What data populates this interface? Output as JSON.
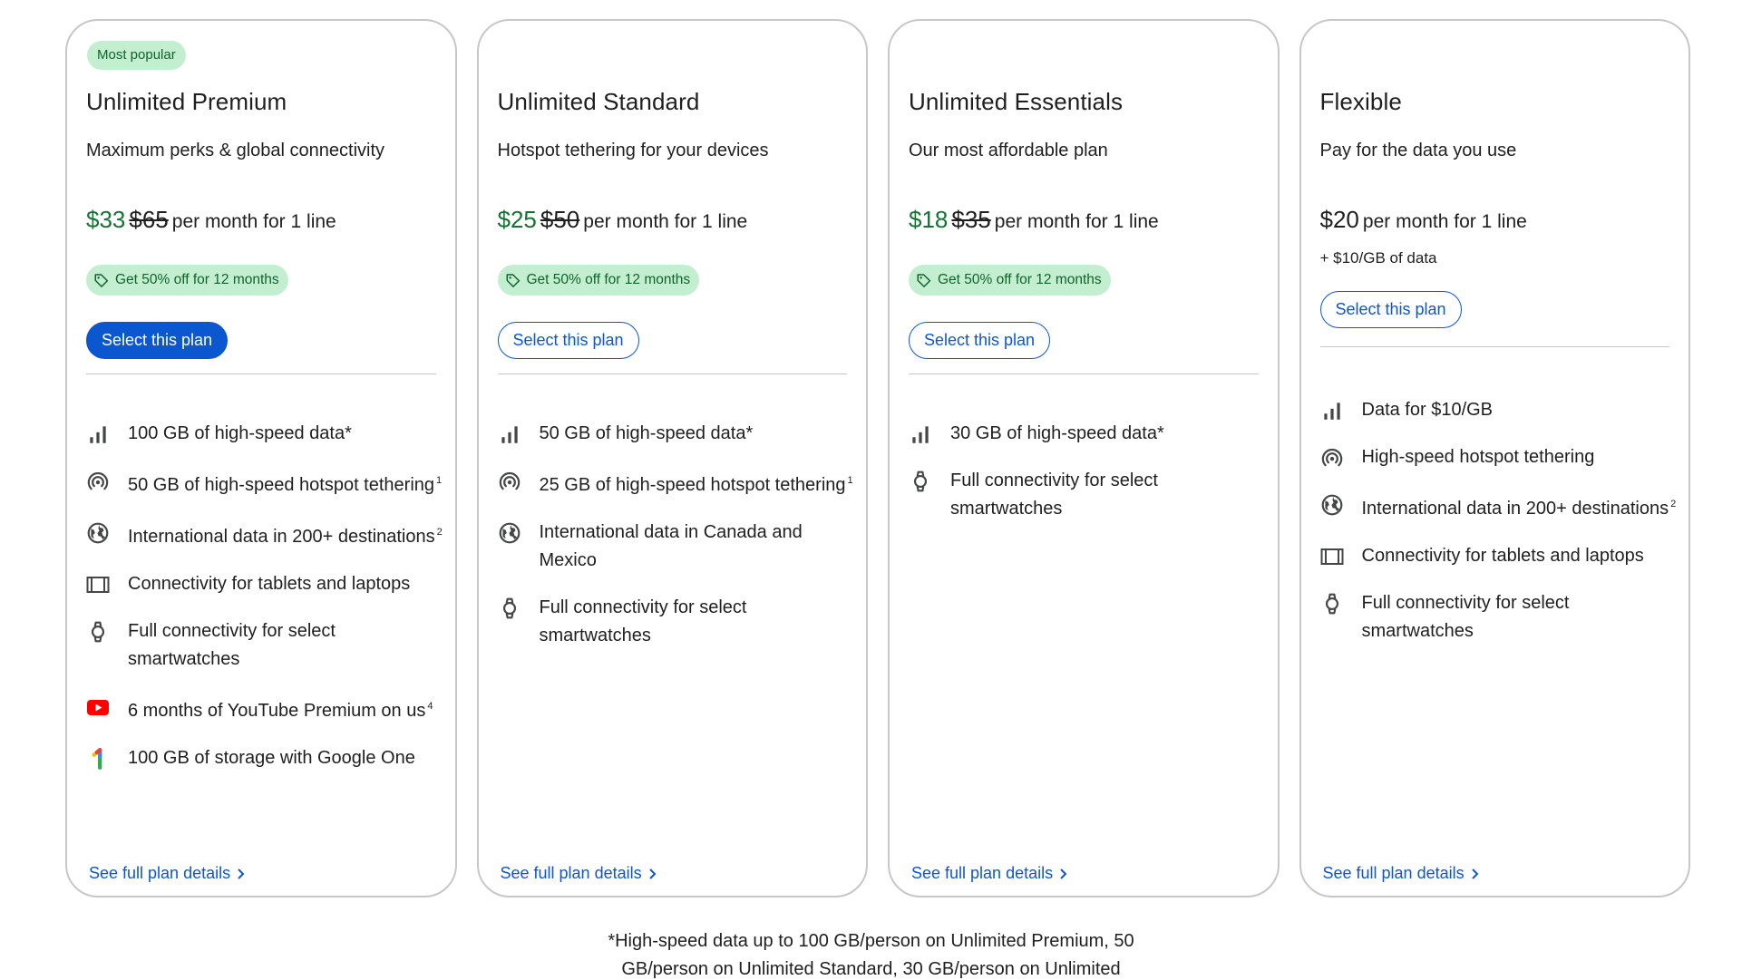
{
  "plans": [
    {
      "badge": "Most popular",
      "title": "Unlimited Premium",
      "subtitle": "Maximum perks & global connectivity",
      "price_now": "$33",
      "price_was": "$65",
      "price_unit": "per month for 1 line",
      "promo": "Get 50% off for 12 months",
      "select_label": "Select this plan",
      "features": [
        {
          "icon": "signal-bars-icon",
          "text": "100 GB of high-speed data*",
          "sup": ""
        },
        {
          "icon": "hotspot-icon",
          "text": "50 GB of high-speed hotspot tethering",
          "sup": "1"
        },
        {
          "icon": "globe-icon",
          "text": "International data in 200+ destinations",
          "sup": "2"
        },
        {
          "icon": "tablet-icon",
          "text": "Connectivity for tablets and laptops",
          "sup": ""
        },
        {
          "icon": "smartwatch-icon",
          "text": "Full connectivity for select smartwatches",
          "sup": ""
        },
        {
          "icon": "youtube-icon",
          "text": "6 months of YouTube Premium on us",
          "sup": "4"
        },
        {
          "icon": "google-one-icon",
          "text": "100 GB of storage with Google One",
          "sup": ""
        }
      ],
      "details_label": "See full plan details"
    },
    {
      "title": "Unlimited Standard",
      "subtitle": "Hotspot tethering for your devices",
      "price_now": "$25",
      "price_was": "$50",
      "price_unit": "per month for 1 line",
      "promo": "Get 50% off for 12 months",
      "select_label": "Select this plan",
      "features": [
        {
          "icon": "signal-bars-icon",
          "text": "50 GB of high-speed data*",
          "sup": ""
        },
        {
          "icon": "hotspot-icon",
          "text": "25 GB of high-speed hotspot tethering",
          "sup": "1"
        },
        {
          "icon": "globe-icon",
          "text": "International data in Canada and Mexico",
          "sup": ""
        },
        {
          "icon": "smartwatch-icon",
          "text": "Full connectivity for select smartwatches",
          "sup": ""
        }
      ],
      "details_label": "See full plan details"
    },
    {
      "title": "Unlimited Essentials",
      "subtitle": "Our most affordable plan",
      "price_now": "$18",
      "price_was": "$35",
      "price_unit": "per month for 1 line",
      "promo": "Get 50% off for 12 months",
      "select_label": "Select this plan",
      "features": [
        {
          "icon": "signal-bars-icon",
          "text": "30 GB of high-speed data*",
          "sup": ""
        },
        {
          "icon": "smartwatch-icon",
          "text": "Full connectivity for select smartwatches",
          "sup": ""
        }
      ],
      "details_label": "See full plan details"
    },
    {
      "title": "Flexible",
      "subtitle": "Pay for the data you use",
      "price_now": "$20",
      "price_unit": "per month for 1 line",
      "price_note": "+ $10/GB of data",
      "select_label": "Select this plan",
      "features": [
        {
          "icon": "signal-bars-icon",
          "text": "Data for $10/GB",
          "sup": ""
        },
        {
          "icon": "hotspot-icon",
          "text": "High-speed hotspot tethering",
          "sup": ""
        },
        {
          "icon": "globe-icon",
          "text": "International data in 200+ destinations",
          "sup": "2"
        },
        {
          "icon": "tablet-icon",
          "text": "Connectivity for tablets and laptops",
          "sup": ""
        },
        {
          "icon": "smartwatch-icon",
          "text": "Full connectivity for select smartwatches",
          "sup": ""
        }
      ],
      "details_label": "See full plan details"
    }
  ],
  "footnote": "*High-speed data up to 100 GB/person on Unlimited Premium, 50 GB/person on Unlimited Standard, 30 GB/person on Unlimited",
  "colors": {
    "accent": "#0b57d0",
    "price_green": "#137333",
    "badge_bg": "#c4eed0",
    "badge_text": "#0d652d",
    "youtube_red": "#ff0000"
  }
}
